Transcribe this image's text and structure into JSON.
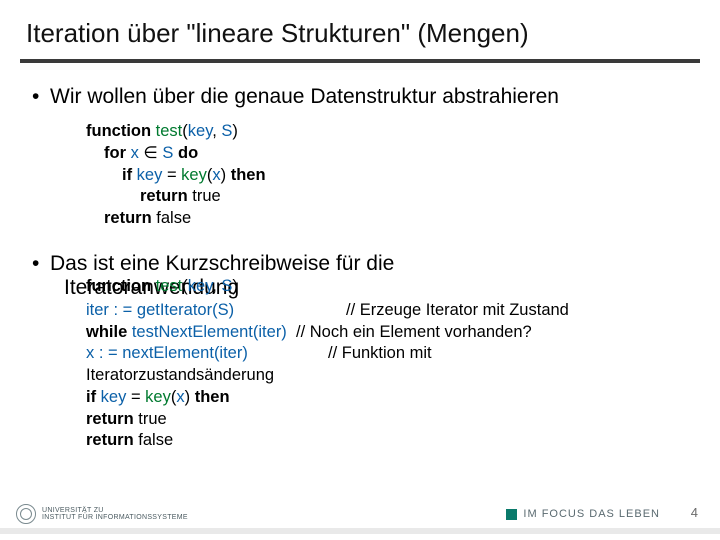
{
  "title": "Iteration über \"lineare Strukturen\" (Mengen)",
  "bullet1": "Wir wollen über die genaue Datenstruktur abstrahieren",
  "code1": {
    "l1": {
      "kw": "function ",
      "fn": "test",
      "p": "(",
      "a1": "key",
      "c": ", ",
      "a2": "S",
      "p2": ")"
    },
    "l2": {
      "kw1": "for ",
      "v": "x",
      "mid": " ∈  ",
      "s": "S",
      "kw2": " do"
    },
    "l3": {
      "kw1": "if ",
      "a": "key ",
      "eq": "= ",
      "fn": "key",
      "p": "(",
      "x": "x",
      "p2": ") ",
      "kw2": "then"
    },
    "l4": {
      "kw": "return ",
      "v": "true"
    },
    "l5": {
      "kw": "return ",
      "v": "false"
    }
  },
  "bullet2_back": "Iteratoranwendung",
  "bullet2_front": {
    "kw": "function ",
    "fn": "test",
    "p": "(",
    "a1": "key",
    "c": ", ",
    "a2": "S",
    "p2": ")"
  },
  "bullet2_intro": "Das ist eine Kurzschreibweise für die",
  "code2": {
    "l1": {
      "a": "iter : = getIterator(S)",
      "c": "// Erzeuge Iterator mit Zustand"
    },
    "l2": {
      "kw": "while ",
      "a": "testNextElement(iter)",
      "c": "  // Noch ein Element vorhanden?"
    },
    "l3": {
      "a": "x : = nextElement(iter)",
      "c": "// Funktion mit"
    },
    "l3b": "Iteratorzustandsänderung",
    "l4": {
      "kw1": "if ",
      "a": "key ",
      "eq": "= ",
      "fn": "key",
      "p": "(",
      "x": "x",
      "p2": ") ",
      "kw2": "then"
    },
    "l5": {
      "kw": "return ",
      "v": "true"
    },
    "l6": {
      "kw": "return ",
      "v": "false"
    }
  },
  "footer": {
    "uni1": "UNIVERSITÄT ZU",
    "uni2": "INSTITUT FÜR INFORMATIONSSYSTEME",
    "focus": "IM FOCUS DAS LEBEN",
    "page": "4"
  }
}
